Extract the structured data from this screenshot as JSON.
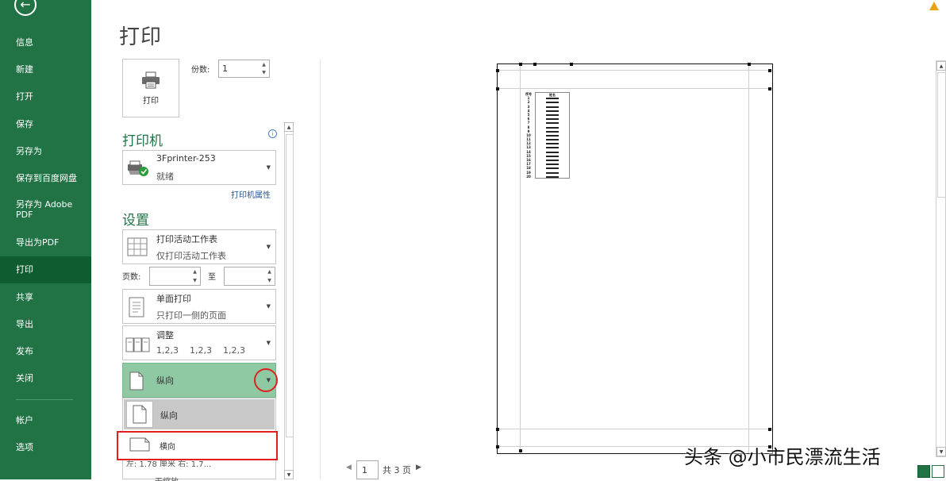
{
  "sidebar": {
    "items": [
      {
        "label": "信息"
      },
      {
        "label": "新建"
      },
      {
        "label": "打开"
      },
      {
        "label": "保存"
      },
      {
        "label": "另存为"
      },
      {
        "label": "保存到百度网盘"
      },
      {
        "label": "另存为 Adobe PDF"
      },
      {
        "label": "导出为PDF"
      },
      {
        "label": "打印"
      },
      {
        "label": "共享"
      },
      {
        "label": "导出"
      },
      {
        "label": "发布"
      },
      {
        "label": "关闭"
      },
      {
        "label": "帐户"
      },
      {
        "label": "选项"
      }
    ],
    "active_label": "打印"
  },
  "page": {
    "title": "打印"
  },
  "print_panel": {
    "print_button_label": "打印",
    "copies_label": "份数:",
    "copies_value": "1",
    "printer_heading": "打印机",
    "printer_name": "3Fprinter-253",
    "printer_status": "就绪",
    "printer_properties_link": "打印机属性",
    "settings_heading": "设置",
    "scope_line1": "打印活动工作表",
    "scope_line2": "仅打印活动工作表",
    "pages_label": "页数:",
    "pages_to_label": "至",
    "sides_line1": "单面打印",
    "sides_line2": "只打印一侧的页面",
    "collate_line1": "调整",
    "collate_line2": "1,2,3    1,2,3    1,2,3",
    "orientation_selected": "纵向",
    "orientation_options": [
      "纵向",
      "横向"
    ],
    "partially_hidden_text_1": "左: 1.78 厘米   右: 1.7...",
    "partially_hidden_text_2": "无缩放"
  },
  "preview": {
    "table_header": [
      "序号",
      "姓名"
    ],
    "rows": [
      "1",
      "2",
      "3",
      "4",
      "5",
      "6",
      "7",
      "8",
      "9",
      "10",
      "11",
      "12",
      "13",
      "14",
      "15",
      "16",
      "17",
      "18",
      "19",
      "20"
    ],
    "current_page": "1",
    "total_pages_text": "共 3 页"
  },
  "watermark": "头条 @小市民漂流生活",
  "icons": [
    "back-arrow-icon",
    "printer-icon",
    "printer-ready-icon",
    "info-icon",
    "sheet-icon",
    "single-side-icon",
    "collate-icon",
    "portrait-icon",
    "landscape-icon",
    "warning-icon"
  ],
  "colors": {
    "accent": "#217346",
    "active": "#0e5c2f",
    "highlight_red": "#e02020",
    "selected_green": "#8fc9a3"
  }
}
